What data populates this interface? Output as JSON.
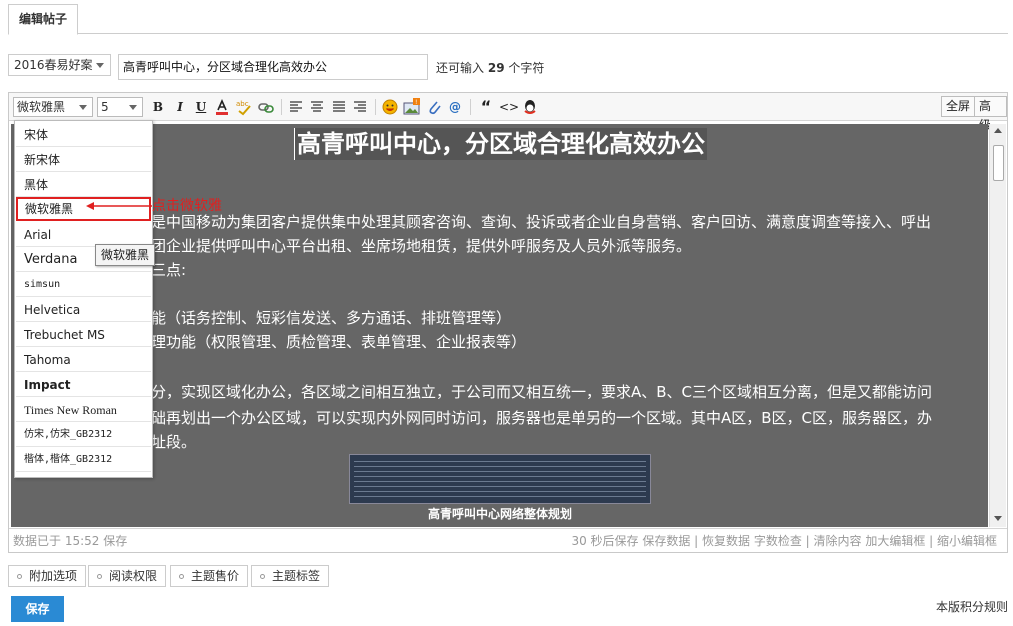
{
  "tab": {
    "label": "编辑帖子"
  },
  "subject": {
    "type_selected": "2016春易好案",
    "title_value": "高青呼叫中心，分区域合理化高效办公",
    "remaining_prefix": "还可输入",
    "remaining_count": "29",
    "remaining_suffix": "个字符"
  },
  "toolbar": {
    "font_value": "微软雅黑",
    "size_value": "5",
    "bold": "B",
    "italic": "I",
    "underline": "U",
    "quote": "“",
    "code": "<>",
    "fullscreen": "全屏",
    "advanced": "高级"
  },
  "font_menu": [
    "宋体",
    "新宋体",
    "黑体",
    "微软雅黑",
    "Arial",
    "Verdana",
    "simsun",
    "Helvetica",
    "Trebuchet MS",
    "Tahoma",
    "Impact",
    "Times New Roman",
    "仿宋,仿宋_GB2312",
    "楷体,楷体_GB2312"
  ],
  "tooltip": "微软雅黑",
  "annotation": "点击微软雅",
  "content": {
    "heading": "高青呼叫中心，分区域合理化高效办公",
    "lines": [
      "是中国移动为集团客户提供集中处理其顾客咨询、查询、投诉或者企业自身营销、客户回访、满意度调查等接入、呼出",
      "团企业提供呼叫中心平台出租、坐席场地租赁，提供外呼服务及人员外派等服务。",
      "三点:",
      "能（话务控制、短彩信发送、多方通话、排班管理等）",
      "理功能（权限管理、质检管理、表单管理、企业报表等）",
      "分，实现区域化办公，各区域之间相互独立，于公司而又相互统一，要求A、B、C三个区域相互分离，但是又都能访问",
      "础再划出一个办公区域，可以实现内外网同时访问，服务器也是单另的一个区域。其中A区，B区，C区，服务器区，办",
      "址段。"
    ],
    "image_caption": "高青呼叫中心网络整体规划"
  },
  "status": {
    "saved": "数据已于 15:52 保存",
    "actions": "30 秒后保存 保存数据 | 恢复数据    字数检查 | 清除内容    加大编辑框 | 缩小编辑框"
  },
  "options": [
    "附加选项",
    "阅读权限",
    "主题售价",
    "主题标签"
  ],
  "save_label": "保存",
  "rules_link": "本版积分规则",
  "colors": {
    "accent": "#2a8ad4",
    "annotation": "#e02020",
    "content_bg": "#666666"
  }
}
